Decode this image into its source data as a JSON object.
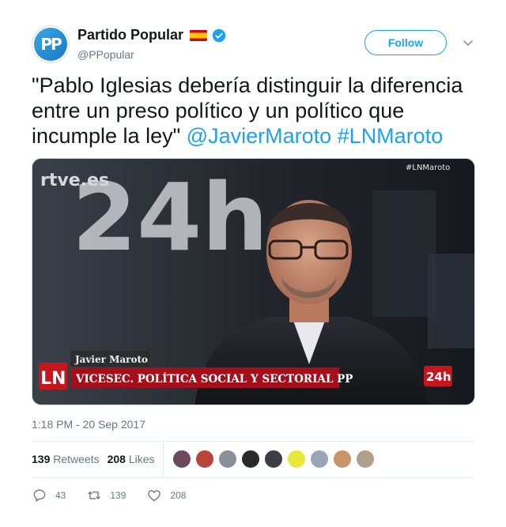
{
  "account": {
    "display_name": "Partido Popular",
    "handle": "@PPopular",
    "avatar_text": "PP"
  },
  "follow_label": "Follow",
  "tweet": {
    "text_plain": "\"Pablo Iglesias debería distinguir la diferencia entre un preso político y un político que incumple la ley\" ",
    "mention": "@JavierMaroto",
    "hashtag": "#LNMaroto"
  },
  "media": {
    "network_logo": "rtve.es",
    "channel": "24h",
    "hashtag_overlay": "#LNMaroto",
    "program_logo": "LN",
    "guest_name": "Javier Maroto",
    "guest_title": "VICESEC. POLÍTICA SOCIAL Y SECTORIAL PP",
    "corner_logo": "24h"
  },
  "timestamp": "1:18 PM - 20 Sep 2017",
  "stats": {
    "retweets_count": "139",
    "retweets_label": "Retweets",
    "likes_count": "208",
    "likes_label": "Likes"
  },
  "likers_colors": [
    "#6b4a5e",
    "#b8443a",
    "#8a8f9a",
    "#2a2a2a",
    "#3a3f45",
    "#e8e83a",
    "#9aa6b8",
    "#c8946a",
    "#b0a08a"
  ],
  "actions": {
    "reply_count": "43",
    "retweet_count": "139",
    "like_count": "208"
  },
  "colors": {
    "accent": "#1da1f2",
    "muted": "#657786",
    "text": "#14171a"
  }
}
